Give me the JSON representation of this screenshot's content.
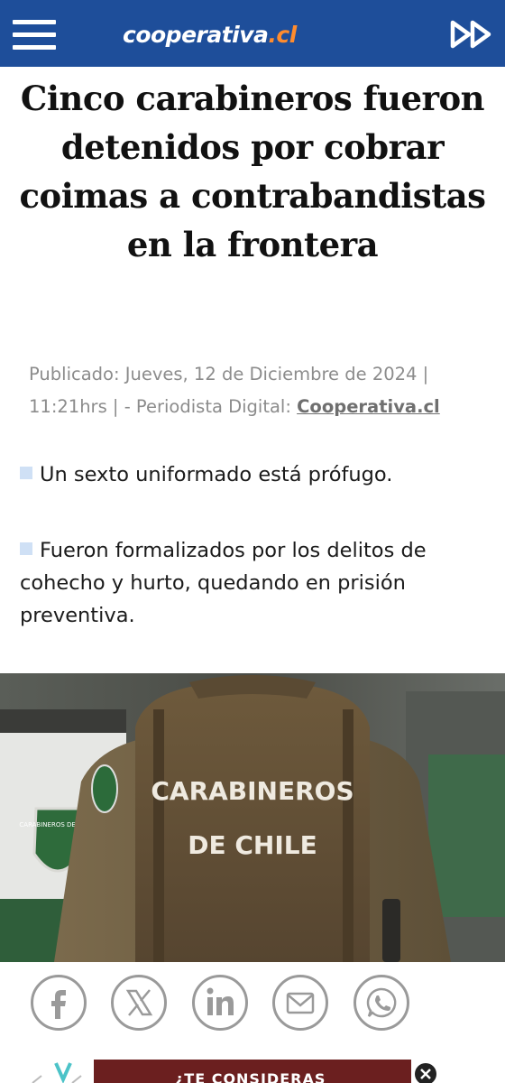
{
  "header": {
    "logo_name": "cooperativa",
    "logo_tld": ".cl",
    "bg_color": "#1e4e9a",
    "tld_color": "#ff8c2e",
    "menu_icon": "hamburger-menu-icon",
    "forward_icon": "double-chevron-right-icon"
  },
  "article": {
    "headline": "Cinco carabineros fueron detenidos por cobrar coimas a contrabandistas en la frontera",
    "meta_text": "Publicado: Jueves, 12 de Diciembre de 2024 | 11:21hrs | - Periodista Digital: ",
    "author_link": "Cooperativa.cl",
    "bullets": [
      "Un sexto uniformado está prófugo.",
      "Fueron formalizados por los delitos de cohecho y hurto, quedando en prisión preventiva."
    ]
  },
  "image": {
    "patch_line1": "CARABINEROS",
    "patch_line2": "DE CHILE",
    "badge_text": "CARABINEROS DE CHILE"
  },
  "share": {
    "buttons": [
      {
        "name": "facebook-icon"
      },
      {
        "name": "x-twitter-icon"
      },
      {
        "name": "linkedin-icon"
      },
      {
        "name": "email-icon"
      },
      {
        "name": "whatsapp-icon"
      }
    ],
    "icon_color": "#9a9a9a"
  },
  "ad": {
    "text": "¿TE CONSIDERAS",
    "close_icon": "close-icon"
  }
}
